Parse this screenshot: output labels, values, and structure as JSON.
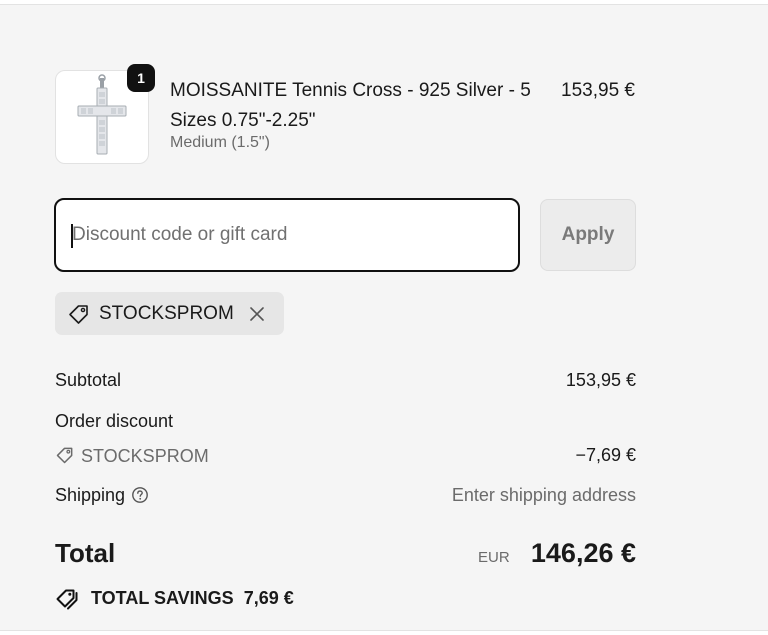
{
  "product": {
    "quantity": "1",
    "title": "MOISSANITE Tennis Cross - 925 Silver - 5 Sizes 0.75\"-2.25\"",
    "variant": "Medium (1.5\")",
    "price": "153,95 €",
    "image_icon": "cross-pendant-image"
  },
  "discount": {
    "placeholder": "Discount code or gift card",
    "value": "",
    "apply_label": "Apply",
    "applied_code": "STOCKSPROM"
  },
  "summary": {
    "subtotal_label": "Subtotal",
    "subtotal_value": "153,95 €",
    "order_discount_label": "Order discount",
    "discount_code": "STOCKSPROM",
    "discount_value": "−7,69 €",
    "shipping_label": "Shipping",
    "shipping_value": "Enter shipping address",
    "total_label": "Total",
    "total_currency": "EUR",
    "total_value": "146,26 €",
    "savings_label": "TOTAL SAVINGS",
    "savings_value": "7,69 €"
  },
  "colors": {
    "background": "#f5f5f5",
    "accent": "#111111",
    "muted_text": "#6b6b6b"
  }
}
